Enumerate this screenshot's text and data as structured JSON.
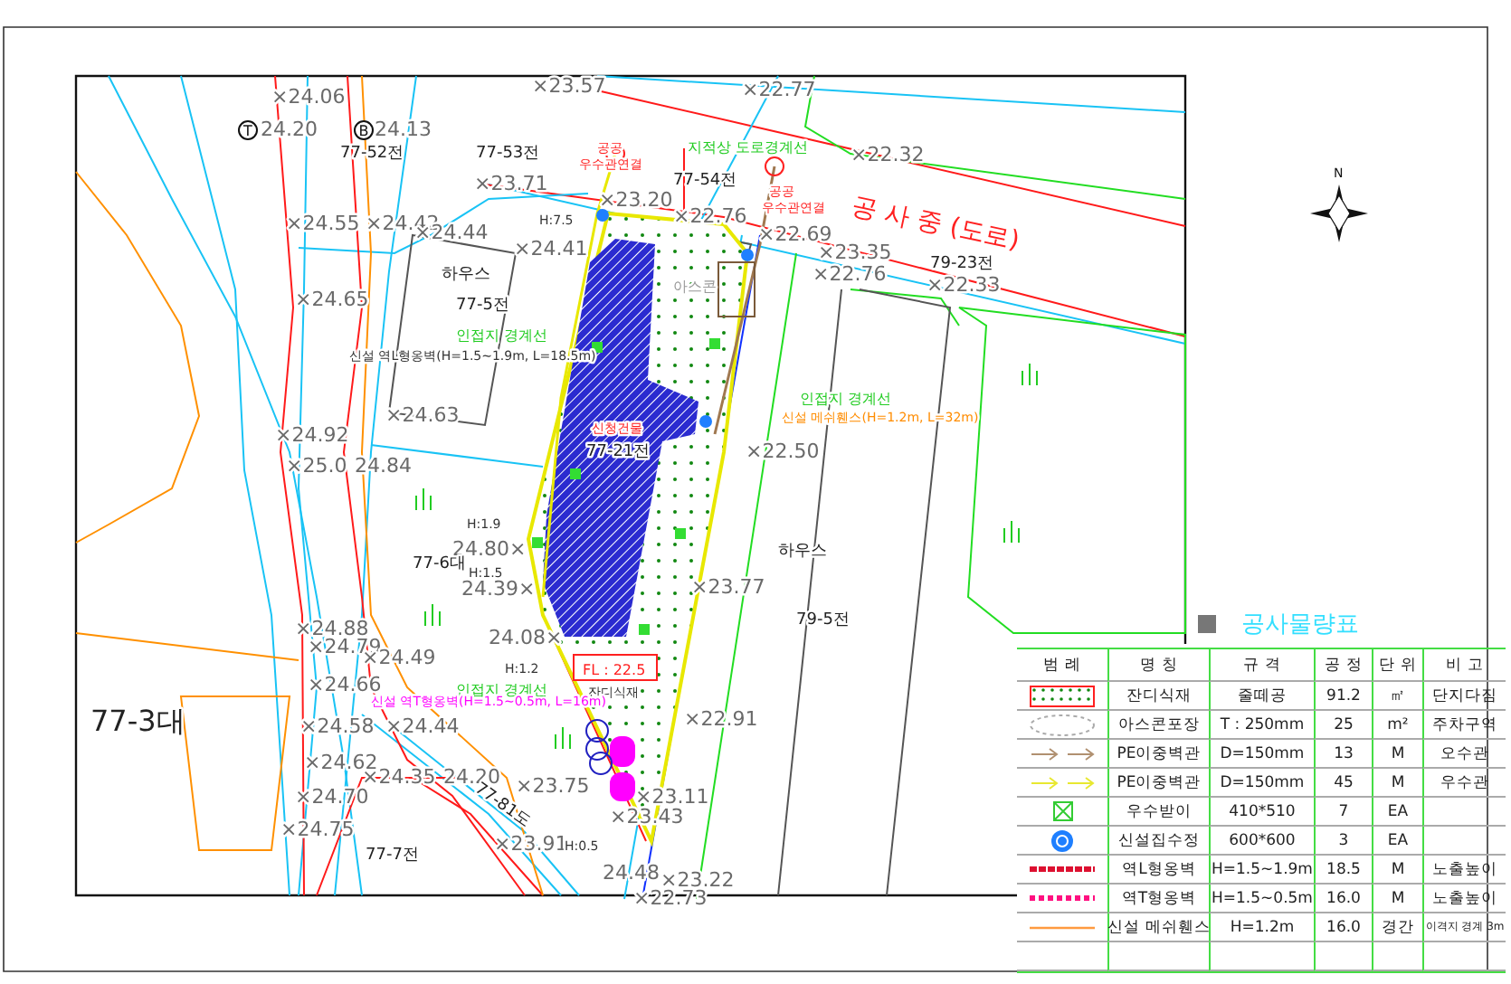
{
  "plan": {
    "north": "N",
    "markers": [
      {
        "text": "T"
      },
      {
        "text": "B"
      }
    ],
    "labels": [
      {
        "text": "×23.57",
        "kind": "elevation"
      },
      {
        "text": "×22.77",
        "kind": "elevation"
      },
      {
        "text": "×24.06",
        "kind": "elevation"
      },
      {
        "text": "24.20",
        "kind": "elevation"
      },
      {
        "text": "24.13",
        "kind": "elevation"
      },
      {
        "text": "77-52전",
        "kind": "parcel"
      },
      {
        "text": "77-53전",
        "kind": "parcel"
      },
      {
        "text": "지적상 도로경계선",
        "kind": "note-green"
      },
      {
        "text": "77-54전",
        "kind": "parcel"
      },
      {
        "text": "공공",
        "kind": "note-red"
      },
      {
        "text": "우수관연결",
        "kind": "note-red"
      },
      {
        "text": "×22.32",
        "kind": "elevation"
      },
      {
        "text": "공공",
        "kind": "note-red"
      },
      {
        "text": "우수관연결",
        "kind": "note-red"
      },
      {
        "text": "공 사 중 (도로)",
        "kind": "road"
      },
      {
        "text": "×23.71",
        "kind": "elevation"
      },
      {
        "text": "×23.20",
        "kind": "elevation"
      },
      {
        "text": "H:7.5",
        "kind": "height"
      },
      {
        "text": "×22.76",
        "kind": "elevation"
      },
      {
        "text": "×22.69",
        "kind": "elevation"
      },
      {
        "text": "×23.35",
        "kind": "elevation"
      },
      {
        "text": "×24.55",
        "kind": "elevation"
      },
      {
        "text": "×24.42",
        "kind": "elevation"
      },
      {
        "text": "×24.44",
        "kind": "elevation"
      },
      {
        "text": "×24.41",
        "kind": "elevation"
      },
      {
        "text": "하우스",
        "kind": "parcel"
      },
      {
        "text": "77-5전",
        "kind": "parcel"
      },
      {
        "text": "79-23전",
        "kind": "parcel"
      },
      {
        "text": "×22.76",
        "kind": "elevation"
      },
      {
        "text": "×22.33",
        "kind": "elevation"
      },
      {
        "text": "아스콘",
        "kind": "faint"
      },
      {
        "text": "×24.65",
        "kind": "elevation"
      },
      {
        "text": "인접지 경계선",
        "kind": "note-green"
      },
      {
        "text": "신설 역L형옹벽(H=1.5~1.9m, L=18.5m)",
        "kind": "note-dark"
      },
      {
        "text": "×24.63",
        "kind": "elevation"
      },
      {
        "text": "×24.92",
        "kind": "elevation"
      },
      {
        "text": "×25.0",
        "kind": "elevation"
      },
      {
        "text": "24.84",
        "kind": "elevation"
      },
      {
        "text": "인접지 경계선",
        "kind": "note-green"
      },
      {
        "text": "신설 메쉬휀스(H=1.2m, L=32m)",
        "kind": "note-orange"
      },
      {
        "text": "신청건물",
        "kind": "note-red"
      },
      {
        "text": "77-21전",
        "kind": "boxed"
      },
      {
        "text": "×22.50",
        "kind": "elevation"
      },
      {
        "text": "H:1.9",
        "kind": "height"
      },
      {
        "text": "24.80×",
        "kind": "elevation"
      },
      {
        "text": "77-6대",
        "kind": "parcel"
      },
      {
        "text": "H:1.5",
        "kind": "height"
      },
      {
        "text": "24.39×",
        "kind": "elevation"
      },
      {
        "text": "하우스",
        "kind": "parcel"
      },
      {
        "text": "×23.77",
        "kind": "elevation"
      },
      {
        "text": "79-5전",
        "kind": "parcel"
      },
      {
        "text": "×24.88",
        "kind": "elevation"
      },
      {
        "text": "×24.79",
        "kind": "elevation"
      },
      {
        "text": "×24.49",
        "kind": "elevation"
      },
      {
        "text": "24.08×",
        "kind": "elevation"
      },
      {
        "text": "H:1.2",
        "kind": "height"
      },
      {
        "text": "FL : 22.5",
        "kind": "fl"
      },
      {
        "text": "×24.66",
        "kind": "elevation"
      },
      {
        "text": "77-3대",
        "kind": "big"
      },
      {
        "text": "인접지 경계선",
        "kind": "note-green"
      },
      {
        "text": "잔디식재",
        "kind": "note-dark"
      },
      {
        "text": "신설 역T형옹벽(H=1.5~0.5m, L=16m)",
        "kind": "note-magenta"
      },
      {
        "text": "×24.58",
        "kind": "elevation"
      },
      {
        "text": "×24.44",
        "kind": "elevation"
      },
      {
        "text": "×22.91",
        "kind": "elevation"
      },
      {
        "text": "×24.62",
        "kind": "elevation"
      },
      {
        "text": "×24.35",
        "kind": "elevation"
      },
      {
        "text": "24.20",
        "kind": "elevation"
      },
      {
        "text": "×24.70",
        "kind": "elevation"
      },
      {
        "text": "×23.75",
        "kind": "elevation"
      },
      {
        "text": "×23.11",
        "kind": "elevation"
      },
      {
        "text": "77-81도",
        "kind": "parcel"
      },
      {
        "text": "×23.43",
        "kind": "elevation"
      },
      {
        "text": "×24.75",
        "kind": "elevation"
      },
      {
        "text": "×23.91",
        "kind": "elevation"
      },
      {
        "text": "77-7전",
        "kind": "parcel"
      },
      {
        "text": "H:0.5",
        "kind": "height"
      },
      {
        "text": "24.48",
        "kind": "elevation"
      },
      {
        "text": "×23.22",
        "kind": "elevation"
      },
      {
        "text": "×22.73",
        "kind": "elevation"
      }
    ]
  },
  "legend": {
    "title": "공사물량표",
    "columns": [
      "범 례",
      "명 칭",
      "규 격",
      "공 정",
      "단 위",
      "비 고"
    ],
    "rows": [
      {
        "kind": "lawn",
        "name": "잔디식재",
        "spec": "줄떼공",
        "qty": "91.2",
        "unit": "㎡",
        "note": "단지다짐"
      },
      {
        "kind": "asphalt",
        "name": "아스콘포장",
        "spec": "T : 250mm",
        "qty": "25",
        "unit": "m²",
        "note": "주차구역"
      },
      {
        "kind": "sewer-pipe",
        "name": "PE이중벽관",
        "spec": "D=150mm",
        "qty": "13",
        "unit": "M",
        "note": "오수관"
      },
      {
        "kind": "storm-pipe",
        "name": "PE이중벽관",
        "spec": "D=150mm",
        "qty": "45",
        "unit": "M",
        "note": "우수관"
      },
      {
        "kind": "inlet",
        "name": "우수받이",
        "spec": "410*510",
        "qty": "7",
        "unit": "EA"
      },
      {
        "kind": "manhole",
        "name": "신설집수정",
        "spec": "600*600",
        "qty": "3",
        "unit": "EA"
      },
      {
        "kind": "l-wall",
        "name": "역L형옹벽",
        "spec": "H=1.5~1.9m",
        "qty": "18.5",
        "unit": "M",
        "note": "노출높이"
      },
      {
        "kind": "t-wall",
        "name": "역T형옹벽",
        "spec": "H=1.5~0.5m",
        "qty": "16.0",
        "unit": "M",
        "note": "노출높이"
      },
      {
        "kind": "fence",
        "name": "신설 메쉬휀스",
        "spec": "H=1.2m",
        "qty": "16.0",
        "unit": "경간",
        "note": "이격지 경계 3m"
      }
    ]
  }
}
